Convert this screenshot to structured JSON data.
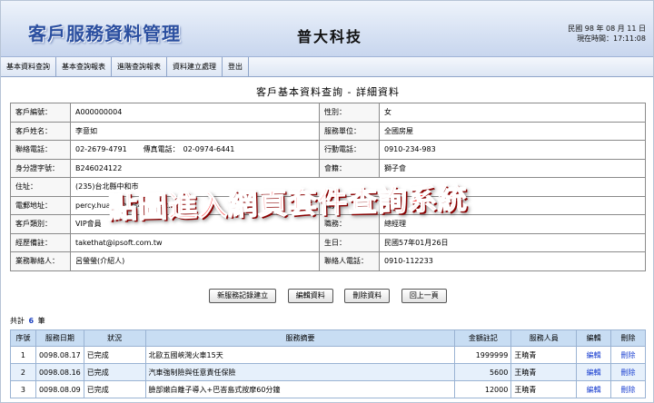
{
  "header": {
    "app_title": "客戶服務資料管理",
    "company": "普大科技",
    "date_line": "民國 98 年 08 月 11 日",
    "time_line": "現在時間：17:11:08"
  },
  "menu": [
    "基本資料查詢",
    "基本查詢報表",
    "進階查詢報表",
    "資料建立處理",
    "登出"
  ],
  "page_title": "客戶基本資料查詢 - 詳細資料",
  "detail": {
    "customer_id_label": "客戶編號：",
    "customer_id": "A000000004",
    "gender_label": "性別：",
    "gender": "女",
    "name_label": "客戶姓名：",
    "name": "李意如",
    "unit_label": "服務單位：",
    "unit": "全國房屋",
    "phone_label": "聯絡電話：",
    "phone": "02-2679-4791",
    "fax_label": "傳真電話：",
    "fax": "02-0974-6441",
    "mobile_label": "行動電話：",
    "mobile": "0910-234-983",
    "id_no_label": "身分證字號：",
    "id_no": "B246024122",
    "society_label": "會籍：",
    "society": "獅子會",
    "address_label": "住址：",
    "address": "(235)台北縣中和市",
    "email_label": "電郵地址：",
    "email": "percy.huang@ms45.hinet.net",
    "title_label_hidden": "職員",
    "category_label": "客戶類別：",
    "category": "VIP會員",
    "position_label": "職務：",
    "position": "總經理",
    "history_label": "經歷備註：",
    "history": "takethat@ipsoft.com.tw",
    "birthday_label": "生日：",
    "birthday": "民國57年01月26日",
    "contact_label": "業務聯絡人：",
    "contact": "呂螢螢(介紹人)",
    "contact_phone_label": "聯絡人電話：",
    "contact_phone": "0910-112233"
  },
  "buttons": {
    "new_record": "新服務記錄建立",
    "edit": "編輯資料",
    "delete": "刪除資料",
    "back": "回上一頁"
  },
  "count": {
    "prefix": "共計",
    "value": "6",
    "suffix": "筆"
  },
  "list": {
    "headers": [
      "序號",
      "服務日期",
      "狀況",
      "服務摘要",
      "金額註記",
      "服務人員",
      "編輯",
      "刪除"
    ],
    "rows": [
      [
        "1",
        "0098.08.17",
        "已完成",
        "北歐五國峽灣火車15天",
        "1999999",
        "王曉青",
        "編輯",
        "刪除"
      ],
      [
        "2",
        "0098.08.16",
        "已完成",
        "汽車強制險與任意責任保險",
        "5600",
        "王曉青",
        "編輯",
        "刪除"
      ],
      [
        "3",
        "0098.08.09",
        "已完成",
        "臉部嫩白離子導入+巴峇島式按摩60分鐘",
        "12000",
        "王曉青",
        "編輯",
        "刪除"
      ]
    ]
  },
  "watermark": "點圖進入網頁套件查詢系統"
}
